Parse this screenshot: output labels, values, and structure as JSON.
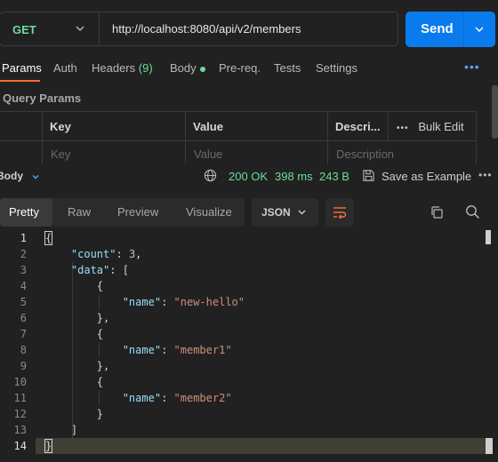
{
  "request": {
    "method": "GET",
    "url": "http://localhost:8080/api/v2/members",
    "send_label": "Send"
  },
  "request_tabs": [
    {
      "label": "Params",
      "active": true
    },
    {
      "label": "Auth"
    },
    {
      "label": "Headers",
      "count": "(9)"
    },
    {
      "label": "Body"
    },
    {
      "label": "Pre-req."
    },
    {
      "label": "Tests"
    },
    {
      "label": "Settings"
    }
  ],
  "more_menu": "•••",
  "query_params": {
    "title": "Query Params",
    "columns": [
      "Key",
      "Value",
      "Descri..."
    ],
    "placeholders": [
      "Key",
      "Value",
      "Description"
    ],
    "bulk_edit": "Bulk Edit",
    "more": "•••"
  },
  "response": {
    "body_label": "Body",
    "status": "200 OK",
    "time": "398 ms",
    "size": "243 B",
    "save_label": "Save as Example",
    "more": "•••"
  },
  "view_tabs": [
    {
      "label": "Pretty",
      "active": true
    },
    {
      "label": "Raw"
    },
    {
      "label": "Preview"
    },
    {
      "label": "Visualize"
    }
  ],
  "format": "JSON",
  "code": {
    "line_numbers": [
      "1",
      "2",
      "3",
      "4",
      "5",
      "6",
      "7",
      "8",
      "9",
      "10",
      "11",
      "12",
      "13",
      "14"
    ],
    "count_key": "\"count\"",
    "count_value": "3",
    "data_key": "\"data\"",
    "name_key": "\"name\"",
    "names": [
      "\"new-hello\"",
      "\"member1\"",
      "\"member2\""
    ],
    "open_brace": "{",
    "close_brace": "}",
    "close_brace_comma": "},",
    "open_bracket": "[",
    "close_bracket": "]"
  },
  "colors": {
    "accent": "#ff6c37",
    "send": "#097bed",
    "success": "#6bdd9a"
  }
}
